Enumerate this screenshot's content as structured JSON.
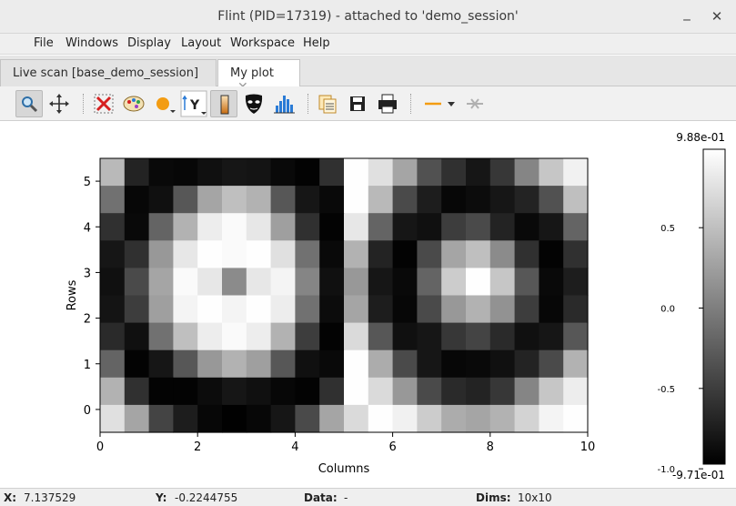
{
  "window": {
    "title": "Flint (PID=17319) - attached to 'demo_session'",
    "minimize_glyph": "_",
    "close_glyph": "✕"
  },
  "menu": {
    "items": [
      {
        "label": "File"
      },
      {
        "label": "Windows"
      },
      {
        "label": "Display"
      },
      {
        "label": "Layout"
      },
      {
        "label": "Workspace"
      },
      {
        "label": "Help"
      }
    ]
  },
  "tabs": [
    {
      "label": "Live scan [base_demo_session]",
      "active": false
    },
    {
      "label": "My plot",
      "active": true,
      "close_glyph": "✕"
    }
  ],
  "toolbar": {
    "buttons": [
      {
        "name": "zoom-icon",
        "pressed": true
      },
      {
        "name": "pan-icon",
        "pressed": false
      },
      {
        "name": "reset-zoom-icon",
        "pressed": false
      },
      {
        "name": "colormap-icon",
        "pressed": false
      },
      {
        "name": "marker-icon",
        "pressed": false
      },
      {
        "name": "y-axis-icon",
        "pressed": false
      },
      {
        "name": "colorbar-toggle-icon",
        "pressed": true
      },
      {
        "name": "mask-icon",
        "pressed": false
      },
      {
        "name": "histogram-icon",
        "pressed": false
      },
      {
        "name": "copy-icon",
        "pressed": false
      },
      {
        "name": "save-icon",
        "pressed": false
      },
      {
        "name": "print-icon",
        "pressed": false
      },
      {
        "name": "line-style-icon",
        "pressed": false
      },
      {
        "name": "crosshair-disabled-icon",
        "pressed": false
      }
    ],
    "y_label": "Y",
    "accent_orange": "#f39c12"
  },
  "chart_data": {
    "type": "heatmap",
    "xlabel": "Columns",
    "ylabel": "Rows",
    "xlim": [
      0,
      10
    ],
    "ylim": [
      -0.5,
      5.5
    ],
    "x_ticks": [
      "0",
      "2",
      "4",
      "6",
      "8",
      "10"
    ],
    "y_ticks": [
      "0",
      "1",
      "2",
      "3",
      "4",
      "5"
    ],
    "rows_top_to_bottom": [
      [
        0.45,
        -0.7,
        -0.9,
        -0.92,
        -0.85,
        -0.8,
        -0.82,
        -0.9,
        -0.95,
        -0.6,
        0.98,
        0.75,
        0.3,
        -0.35,
        -0.6,
        -0.8,
        -0.55,
        0.05,
        0.55,
        0.88
      ],
      [
        -0.1,
        -0.92,
        -0.85,
        -0.3,
        0.3,
        0.5,
        0.4,
        -0.3,
        -0.8,
        -0.9,
        0.98,
        0.45,
        -0.4,
        -0.75,
        -0.92,
        -0.88,
        -0.8,
        -0.7,
        -0.35,
        0.5
      ],
      [
        -0.6,
        -0.9,
        -0.2,
        0.4,
        0.85,
        0.95,
        0.8,
        0.25,
        -0.6,
        -0.95,
        0.8,
        -0.2,
        -0.8,
        -0.85,
        -0.5,
        -0.4,
        -0.7,
        -0.9,
        -0.8,
        -0.2
      ],
      [
        -0.8,
        -0.6,
        0.2,
        0.8,
        0.98,
        0.95,
        0.98,
        0.75,
        -0.1,
        -0.9,
        0.4,
        -0.7,
        -0.95,
        -0.4,
        0.3,
        0.5,
        0.1,
        -0.6,
        -0.95,
        -0.6
      ],
      [
        -0.85,
        -0.4,
        0.3,
        0.95,
        0.8,
        0.1,
        0.8,
        0.9,
        0.05,
        -0.85,
        0.2,
        -0.8,
        -0.9,
        -0.2,
        0.6,
        0.98,
        0.55,
        -0.3,
        -0.9,
        -0.75
      ],
      [
        -0.82,
        -0.5,
        0.25,
        0.9,
        0.98,
        0.9,
        0.98,
        0.85,
        -0.1,
        -0.88,
        0.3,
        -0.75,
        -0.92,
        -0.4,
        0.2,
        0.4,
        0.15,
        -0.5,
        -0.92,
        -0.65
      ],
      [
        -0.65,
        -0.85,
        -0.1,
        0.5,
        0.85,
        0.95,
        0.85,
        0.4,
        -0.5,
        -0.95,
        0.7,
        -0.3,
        -0.85,
        -0.8,
        -0.55,
        -0.45,
        -0.65,
        -0.85,
        -0.8,
        -0.3
      ],
      [
        -0.2,
        -0.95,
        -0.8,
        -0.3,
        0.2,
        0.4,
        0.25,
        -0.3,
        -0.85,
        -0.9,
        0.98,
        0.35,
        -0.4,
        -0.8,
        -0.92,
        -0.9,
        -0.85,
        -0.7,
        -0.4,
        0.4
      ],
      [
        0.4,
        -0.6,
        -0.95,
        -0.95,
        -0.88,
        -0.8,
        -0.85,
        -0.92,
        -0.95,
        -0.6,
        0.98,
        0.7,
        0.2,
        -0.4,
        -0.65,
        -0.7,
        -0.55,
        0.05,
        0.55,
        0.85
      ],
      [
        0.75,
        0.3,
        -0.45,
        -0.75,
        -0.92,
        -0.96,
        -0.92,
        -0.8,
        -0.4,
        0.3,
        0.7,
        0.98,
        0.88,
        0.6,
        0.35,
        0.3,
        0.4,
        0.65,
        0.9,
        0.98
      ]
    ],
    "colorbar": {
      "max_label": "9.88e-01",
      "min_label": "-9.71e-01",
      "ticks": [
        {
          "value": 0.5,
          "label": "0.5"
        },
        {
          "value": 0.0,
          "label": "0.0"
        },
        {
          "value": -0.5,
          "label": "-0.5"
        },
        {
          "value": -1.0,
          "label": "-1.0"
        }
      ],
      "vmin": -0.971,
      "vmax": 0.988
    }
  },
  "status": {
    "x_label": "X:",
    "x_value": "7.137529",
    "y_label": "Y:",
    "y_value": "-0.2244755",
    "data_label": "Data:",
    "data_value": "-",
    "dims_label": "Dims:",
    "dims_value": "10x10"
  }
}
